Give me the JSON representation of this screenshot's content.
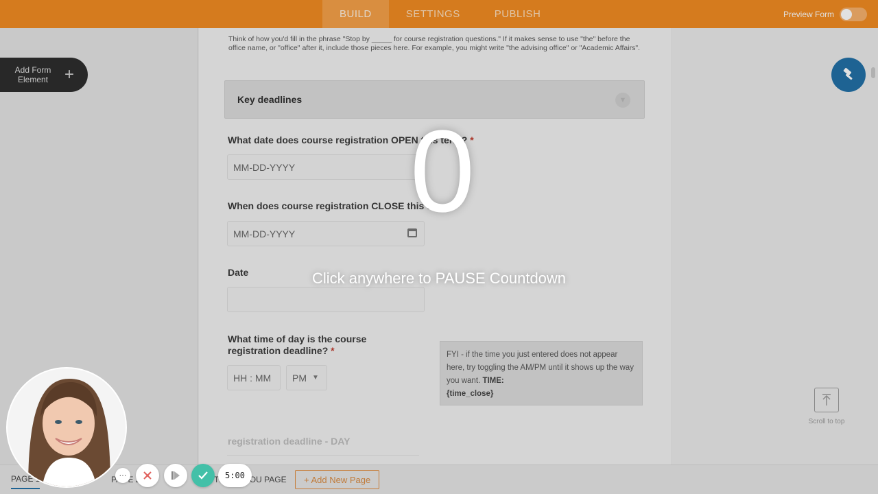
{
  "topbar": {
    "tabs": [
      {
        "label": "BUILD",
        "active": true
      },
      {
        "label": "SETTINGS",
        "active": false
      },
      {
        "label": "PUBLISH",
        "active": false
      }
    ],
    "preview_label": "Preview Form",
    "accent_color": "#f28a1f"
  },
  "left_panel": {
    "add_element_label": "Add Form Element",
    "add_icon": "plus-icon"
  },
  "form": {
    "help_text": "Think of how you'd fill in the phrase \"Stop by _____ for course registration questions.\" If it makes sense to use \"the\" before the office name, or \"office\" after it, include those pieces here. For example, you might write \"the advising office\" or \"Academic Affairs\".",
    "section_title": "Key deadlines",
    "q_open": {
      "label": "What date does course registration OPEN this term?",
      "placeholder": "MM-DD-YYYY"
    },
    "q_close": {
      "label": "When does course registration CLOSE this term?",
      "placeholder": "MM-DD-YYYY"
    },
    "q_date": {
      "label": "Date",
      "value": ""
    },
    "q_time": {
      "label": "What time of day is the course registration deadline?",
      "time_placeholder": "HH : MM",
      "ampm": "PM"
    },
    "fyi_text": "FYI - if the time you just entered does not appear here, try toggling the AM/PM until it shows up the way you want.",
    "fyi_time_label": "TIME:",
    "fyi_time_token": "{time_close}",
    "faded_label": "registration deadline - DAY",
    "required_marker": "*"
  },
  "right_panel": {
    "scroll_to_top_label": "Scroll to top",
    "fab_icon": "hammer-icon"
  },
  "bottom_bar": {
    "page1_label": "PAGE 1",
    "page2_label": "PAGE 2",
    "thankyou_label": "THANK YOU PAGE",
    "add_page_label": "+ Add New Page"
  },
  "recorder": {
    "countdown_value": "0",
    "pause_message": "Click anywhere to PAUSE Countdown",
    "timer": "5:00",
    "more_label": "···",
    "done_color": "#43c0a8"
  }
}
